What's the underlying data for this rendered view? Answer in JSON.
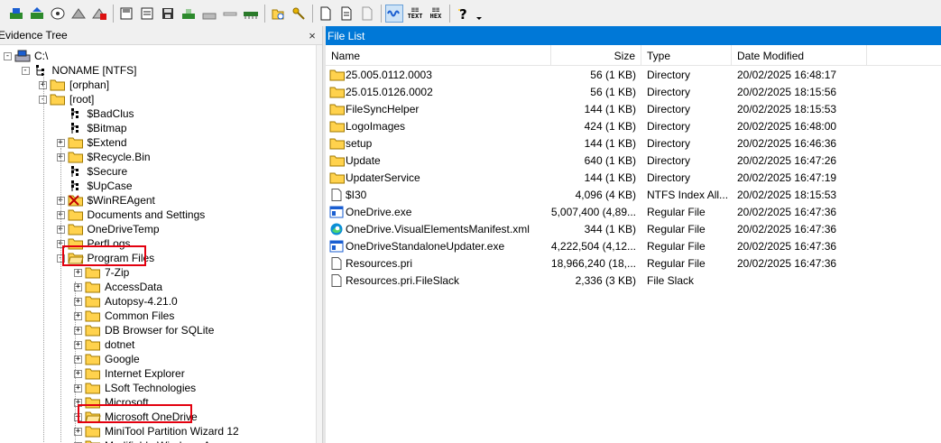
{
  "toolbar": {
    "text_button": "TEXT",
    "hex_button": "HEX"
  },
  "evidence_tree": {
    "title": "Evidence Tree",
    "close": "×",
    "nodes": [
      {
        "label": "C:\\",
        "icon": "drive-icon"
      },
      {
        "label": "NONAME [NTFS]",
        "icon": "filesystem-icon"
      },
      {
        "label": "[orphan]",
        "icon": "folder-icon"
      },
      {
        "label": "[root]",
        "icon": "folder-icon"
      },
      {
        "label": "$BadClus",
        "icon": "system-file-icon"
      },
      {
        "label": "$Bitmap",
        "icon": "system-file-icon"
      },
      {
        "label": "$Extend",
        "icon": "folder-icon"
      },
      {
        "label": "$Recycle.Bin",
        "icon": "folder-icon"
      },
      {
        "label": "$Secure",
        "icon": "system-file-icon"
      },
      {
        "label": "$UpCase",
        "icon": "system-file-icon"
      },
      {
        "label": "$WinREAgent",
        "icon": "deleted-folder-icon"
      },
      {
        "label": "Documents and Settings",
        "icon": "folder-icon"
      },
      {
        "label": "OneDriveTemp",
        "icon": "folder-icon"
      },
      {
        "label": "PerfLogs",
        "icon": "folder-icon"
      },
      {
        "label": "Program Files",
        "icon": "folder-open-icon"
      },
      {
        "label": "7-Zip",
        "icon": "folder-icon"
      },
      {
        "label": "AccessData",
        "icon": "folder-icon"
      },
      {
        "label": "Autopsy-4.21.0",
        "icon": "folder-icon"
      },
      {
        "label": "Common Files",
        "icon": "folder-icon"
      },
      {
        "label": "DB Browser for SQLite",
        "icon": "folder-icon"
      },
      {
        "label": "dotnet",
        "icon": "folder-icon"
      },
      {
        "label": "Google",
        "icon": "folder-icon"
      },
      {
        "label": "Internet Explorer",
        "icon": "folder-icon"
      },
      {
        "label": "LSoft Technologies",
        "icon": "folder-icon"
      },
      {
        "label": "Microsoft",
        "icon": "folder-icon"
      },
      {
        "label": "Microsoft OneDrive",
        "icon": "folder-open-icon"
      },
      {
        "label": "MiniTool Partition Wizard 12",
        "icon": "folder-icon"
      },
      {
        "label": "Modifiable Windows A...",
        "icon": "folder-icon"
      }
    ]
  },
  "file_list": {
    "title": "File List",
    "columns": [
      "Name",
      "Size",
      "Type",
      "Date Modified"
    ],
    "rows": [
      {
        "name": "25.005.0112.0003",
        "size": "56 (1 KB)",
        "type": "Directory",
        "date": "20/02/2025 16:48:17",
        "icon": "folder-icon"
      },
      {
        "name": "25.015.0126.0002",
        "size": "56 (1 KB)",
        "type": "Directory",
        "date": "20/02/2025 18:15:56",
        "icon": "folder-icon"
      },
      {
        "name": "FileSyncHelper",
        "size": "144 (1 KB)",
        "type": "Directory",
        "date": "20/02/2025 18:15:53",
        "icon": "folder-icon"
      },
      {
        "name": "LogoImages",
        "size": "424 (1 KB)",
        "type": "Directory",
        "date": "20/02/2025 16:48:00",
        "icon": "folder-icon"
      },
      {
        "name": "setup",
        "size": "144 (1 KB)",
        "type": "Directory",
        "date": "20/02/2025 16:46:36",
        "icon": "folder-icon"
      },
      {
        "name": "Update",
        "size": "640 (1 KB)",
        "type": "Directory",
        "date": "20/02/2025 16:47:26",
        "icon": "folder-icon"
      },
      {
        "name": "UpdaterService",
        "size": "144 (1 KB)",
        "type": "Directory",
        "date": "20/02/2025 16:47:19",
        "icon": "folder-icon"
      },
      {
        "name": "$I30",
        "size": "4,096 (4 KB)",
        "type": "NTFS Index All...",
        "date": "20/02/2025 18:15:53",
        "icon": "file-icon"
      },
      {
        "name": "OneDrive.exe",
        "size": "5,007,400 (4,89...",
        "type": "Regular File",
        "date": "20/02/2025 16:47:36",
        "icon": "exe-icon"
      },
      {
        "name": "OneDrive.VisualElementsManifest.xml",
        "size": "344 (1 KB)",
        "type": "Regular File",
        "date": "20/02/2025 16:47:36",
        "icon": "edge-icon"
      },
      {
        "name": "OneDriveStandaloneUpdater.exe",
        "size": "4,222,504 (4,12...",
        "type": "Regular File",
        "date": "20/02/2025 16:47:36",
        "icon": "exe-icon"
      },
      {
        "name": "Resources.pri",
        "size": "18,966,240 (18,...",
        "type": "Regular File",
        "date": "20/02/2025 16:47:36",
        "icon": "file-icon"
      },
      {
        "name": "Resources.pri.FileSlack",
        "size": "2,336 (3 KB)",
        "type": "File Slack",
        "date": "",
        "icon": "file-icon"
      }
    ]
  },
  "colors": {
    "accent": "#0078d7",
    "highlight": "#e3000f",
    "folder": "#ffd24d"
  }
}
